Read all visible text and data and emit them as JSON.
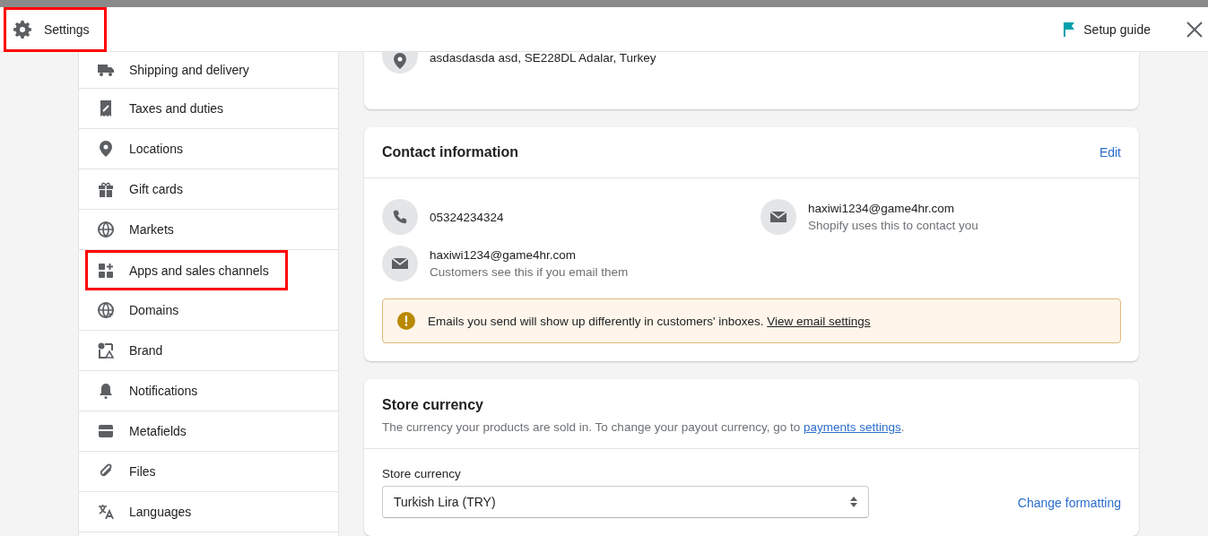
{
  "header": {
    "title": "Settings",
    "highlighted": true,
    "setup_guide": "Setup guide"
  },
  "sidebar": {
    "items": [
      {
        "label": "Shipping and delivery",
        "highlighted": false
      },
      {
        "label": "Taxes and duties",
        "highlighted": false
      },
      {
        "label": "Locations",
        "highlighted": false
      },
      {
        "label": "Gift cards",
        "highlighted": false
      },
      {
        "label": "Markets",
        "highlighted": false
      },
      {
        "label": "Apps and sales channels",
        "highlighted": true
      },
      {
        "label": "Domains",
        "highlighted": false
      },
      {
        "label": "Brand",
        "highlighted": false
      },
      {
        "label": "Notifications",
        "highlighted": false
      },
      {
        "label": "Metafields",
        "highlighted": false
      },
      {
        "label": "Files",
        "highlighted": false
      },
      {
        "label": "Languages",
        "highlighted": false
      }
    ]
  },
  "address": {
    "text": "asdasdasda asd, SE228DL Adalar, Turkey"
  },
  "contact": {
    "title": "Contact information",
    "edit": "Edit",
    "entries": [
      {
        "kind": "phone",
        "value": "05324234324"
      },
      {
        "kind": "email",
        "value": "haxiwi1234@game4hr.com",
        "note": "Shopify uses this to contact you"
      },
      {
        "kind": "email",
        "value": "haxiwi1234@game4hr.com",
        "note": "Customers see this if you email them"
      }
    ],
    "banner": {
      "text": "Emails you send will show up differently in customers' inboxes.",
      "link": "View email settings"
    }
  },
  "currency": {
    "title": "Store currency",
    "description": "The currency your products are sold in. To change your payout currency, go to",
    "link": "payments settings",
    "after": ".",
    "field_label": "Store currency",
    "value": "Turkish Lira (TRY)",
    "formatting": "Change formatting"
  }
}
